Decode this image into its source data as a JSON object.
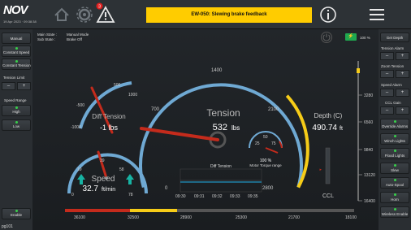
{
  "top": {
    "brand": "NOV",
    "timestamp": "19 Apr 2023 · 09:38:38",
    "alarm": "EW-050: Slewing brake feedback",
    "alarm_badge": "3"
  },
  "states": {
    "main_label": "Main State :",
    "main_value": "Manual Mode",
    "sub_label": "Sub State :",
    "sub_value": "Brake Off"
  },
  "left": {
    "manual": "Manual",
    "constant_speed": "Constant Speed",
    "constant_tension": "Constant Tension",
    "tension_limit": "Tension Limit",
    "minus": "–",
    "plus": "+",
    "speed_range": "Speed Range",
    "high": "High",
    "low": "Low",
    "enable": "Enable",
    "footer": "pg101"
  },
  "right": {
    "battery_pct": "100 %",
    "get_depth": "Get Depth",
    "tension_alarm": "Tension Alarm",
    "zoom_tension": "Zoom Tension",
    "speed_alarm": "Speed Alarm",
    "ccl_gain": "CCL Gain",
    "override_alarms": "Override Alarms",
    "winch_lights": "Winch Lights",
    "flood_lights": "Flood Lights",
    "slew": "Slew",
    "auto_spool": "Auto-Spool",
    "horn": "Horn",
    "wireless_enable": "Wireless Enable"
  },
  "tension": {
    "title": "Tension",
    "value": "532",
    "unit": "lbs",
    "ticks": [
      "0",
      "700",
      "1400",
      "2100",
      "2800"
    ],
    "max": 2800,
    "reading": 532
  },
  "diff": {
    "title": "Diff Tension",
    "value": "-1 lbs",
    "ticks": [
      "-1000",
      "-500",
      "500",
      "1000"
    ]
  },
  "speed": {
    "title": "Speed",
    "value": "32.7",
    "unit": "ft/min",
    "ticks": [
      "0",
      "19",
      "39",
      "58",
      "78"
    ]
  },
  "motor": {
    "pct": "100 %",
    "label": "Motor Torque range",
    "ticks": [
      "25",
      "50",
      "75"
    ]
  },
  "trend": {
    "title": "Diff Tension",
    "times": [
      "09:30",
      "09:31",
      "09:32",
      "09:33",
      "09:35"
    ]
  },
  "depth": {
    "title": "Depth (C)",
    "value": "490.74",
    "unit": "ft",
    "ticks": [
      "3280",
      "6560",
      "9840",
      "13120",
      "16400"
    ],
    "ccl": "CCL"
  },
  "bottom_scale": [
    "36100",
    "32500",
    "28900",
    "25300",
    "21700",
    "18100"
  ]
}
